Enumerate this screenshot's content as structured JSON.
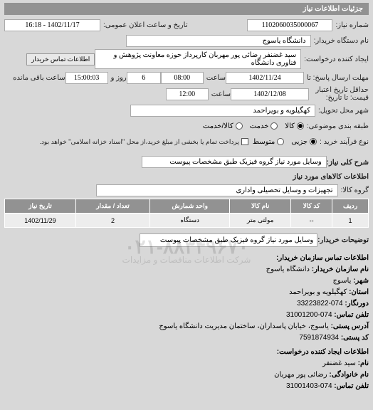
{
  "header": {
    "title": "جزئیات اطلاعات نیاز"
  },
  "fields": {
    "req_no_label": "شماره نیاز:",
    "req_no": "1102060035000067",
    "announce_label": "تاریخ و ساعت اعلان عمومی:",
    "announce": "1402/11/17 - 16:18",
    "buyer_org_label": "نام دستگاه خریدار:",
    "buyer_org": "دانشگاه یاسوج",
    "requester_label": "ایجاد کننده درخواست:",
    "requester": "سید غضنفر رضائی پور مهربان کارپرداز حوزه معاونت پژوهش و فناوری دانشگاه",
    "contact_btn": "اطلاعات تماس خریدار",
    "deadline_label": "مهلت ارسال پاسخ: تا",
    "deadline_date": "1402/11/24",
    "deadline_time_lbl": "ساعت",
    "deadline_time": "08:00",
    "and_lbl": "روز و",
    "days_remain": "6",
    "hours_remain": "15:00:03",
    "remain_lbl": "ساعت باقی مانده",
    "valid_until_label": "حداقل تاریخ اعتبار قیمت: تا تاریخ:",
    "valid_date": "1402/12/08",
    "valid_time": "12:00",
    "delivery_city_label": "شهر محل تحویل:",
    "delivery_city": "کهگیلویه و بویراحمد",
    "subject_type_label": "طبقه بندی موضوعی:",
    "subject_goods": "کالا",
    "subject_service": "خدمت",
    "subject_both": "کالا/خدمت",
    "process_label": "نوع فرآیند خرید :",
    "proc_minor": "جزیی",
    "proc_medium": "متوسط",
    "proc_note": "پرداخت تمام یا بخشی از مبلغ خرید،از محل \"اسناد خزانه اسلامی\" خواهد بود.",
    "desc_label": "شرح کلی نیاز:",
    "desc": "وسایل مورد نیاز گروه فیزیک طبق مشخصات پیوست",
    "goods_header": "اطلاعات کالاهای مورد نیاز",
    "group_label": "گروه کالا:",
    "group": "تجهیزات و وسایل تحصیلی واداری",
    "buyer_desc_label": "توضیحات خریدار:",
    "buyer_desc": "وسایل مورد نیاز گروه فیزیک طبق مشخصات پیوست"
  },
  "table": {
    "headers": [
      "ردیف",
      "کد کالا",
      "نام کالا",
      "واحد شمارش",
      "تعداد / مقدار",
      "تاریخ نیاز"
    ],
    "rows": [
      {
        "idx": "1",
        "code": "--",
        "name": "مولتی متر",
        "unit": "دستگاه",
        "qty": "2",
        "date": "1402/11/29"
      }
    ]
  },
  "contact": {
    "section": "اطلاعات تماس سازمان خریدار:",
    "org_name_label": "نام سازمان خریدار:",
    "org_name": "دانشگاه یاسوج",
    "city_label": "شهر:",
    "city": "یاسوج",
    "province_label": "استان:",
    "province": "کهگیلویه و بویراحمد",
    "phone_label": "دورنگار:",
    "phone": "074-33223822",
    "fax_label": "تلفن تماس:",
    "fax": "074-31001200",
    "address_label": "آدرس پستی:",
    "address": "یاسوج، خیابان پاسداران، ساختمان مدیریت دانشگاه یاسوج",
    "postal_label": "کد پستی:",
    "postal": "7591874934",
    "req_creator_section": "اطلاعات ایجاد کننده درخواست:",
    "name_label": "نام:",
    "name": "سید غضنفر",
    "lname_label": "نام خانوادگی:",
    "lname": "رضائی پور مهربان",
    "tel_label": "تلفن تماس:",
    "tel": "074-31001403"
  },
  "watermark": {
    "main": "۰۲۱-۸۸۳۴۹۶۷۰",
    "sub": "شرکت اطلاعات مناقصات و مزایدات"
  }
}
